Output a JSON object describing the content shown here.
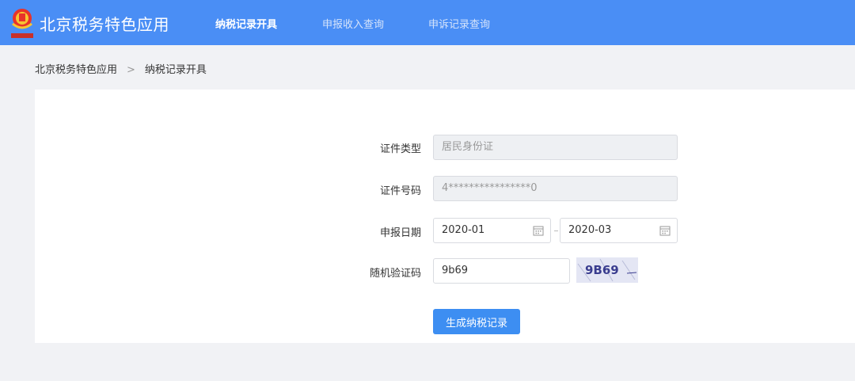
{
  "header": {
    "app_title": "北京税务特色应用",
    "nav": [
      {
        "label": "纳税记录开具",
        "active": true
      },
      {
        "label": "申报收入查询",
        "active": false
      },
      {
        "label": "申诉记录查询",
        "active": false
      }
    ]
  },
  "breadcrumb": {
    "root": "北京税务特色应用",
    "separator": ">",
    "current": "纳税记录开具"
  },
  "form": {
    "id_type": {
      "label": "证件类型",
      "value": "居民身份证"
    },
    "id_number": {
      "label": "证件号码",
      "value": "4****************0"
    },
    "report_date": {
      "label": "申报日期",
      "start": "2020-01",
      "end": "2020-03"
    },
    "captcha": {
      "label": "随机验证码",
      "value": "9b69",
      "image_text": "9B69"
    },
    "submit_label": "生成纳税记录"
  },
  "colors": {
    "header_bg": "#4a8ef5",
    "primary_button": "#3d8ef2",
    "page_bg": "#f1f2f5"
  }
}
